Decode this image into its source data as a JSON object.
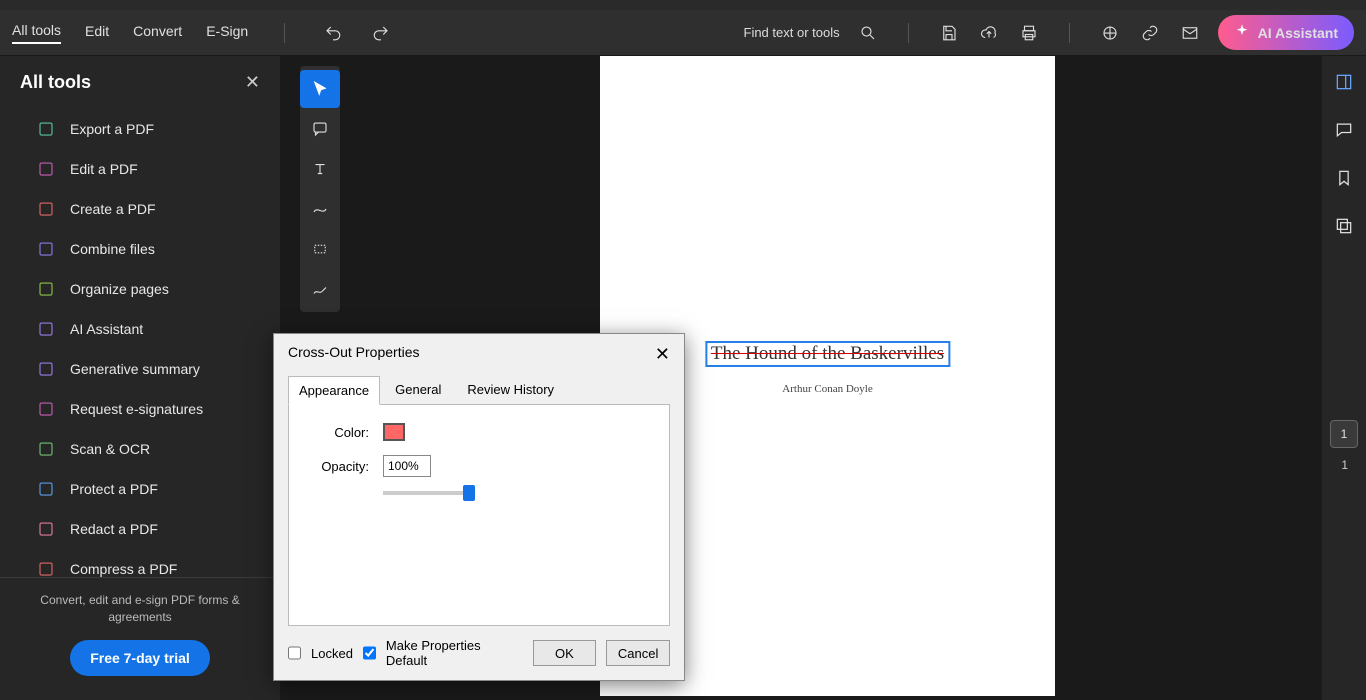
{
  "menu": {
    "items": [
      "All tools",
      "Edit",
      "Convert",
      "E-Sign"
    ],
    "search": "Find text or tools",
    "ai": "AI Assistant"
  },
  "sidebar": {
    "title": "All tools",
    "items": [
      {
        "label": "Export a PDF",
        "color": "#57c1a5"
      },
      {
        "label": "Edit a PDF",
        "color": "#c75db7"
      },
      {
        "label": "Create a PDF",
        "color": "#e06666"
      },
      {
        "label": "Combine files",
        "color": "#8a7ce8"
      },
      {
        "label": "Organize pages",
        "color": "#8bc34a"
      },
      {
        "label": "AI Assistant",
        "color": "#9a7ce8"
      },
      {
        "label": "Generative summary",
        "color": "#9a7ce8"
      },
      {
        "label": "Request e-signatures",
        "color": "#c75db7"
      },
      {
        "label": "Scan & OCR",
        "color": "#6fbf73"
      },
      {
        "label": "Protect a PDF",
        "color": "#5c9de8"
      },
      {
        "label": "Redact a PDF",
        "color": "#e07ba0"
      },
      {
        "label": "Compress a PDF",
        "color": "#e06666"
      }
    ],
    "footer": "Convert, edit and e-sign PDF forms & agreements",
    "trial": "Free 7-day trial"
  },
  "document": {
    "title": "The Hound of the Baskervilles",
    "author": "Arthur Conan Doyle"
  },
  "page_indicator": {
    "current": "1",
    "total": "1"
  },
  "dialog": {
    "title": "Cross-Out Properties",
    "tabs": [
      "Appearance",
      "General",
      "Review History"
    ],
    "color_label": "Color:",
    "opacity_label": "Opacity:",
    "opacity_value": "100%",
    "locked": "Locked",
    "make_default": "Make Properties Default",
    "ok": "OK",
    "cancel": "Cancel"
  }
}
